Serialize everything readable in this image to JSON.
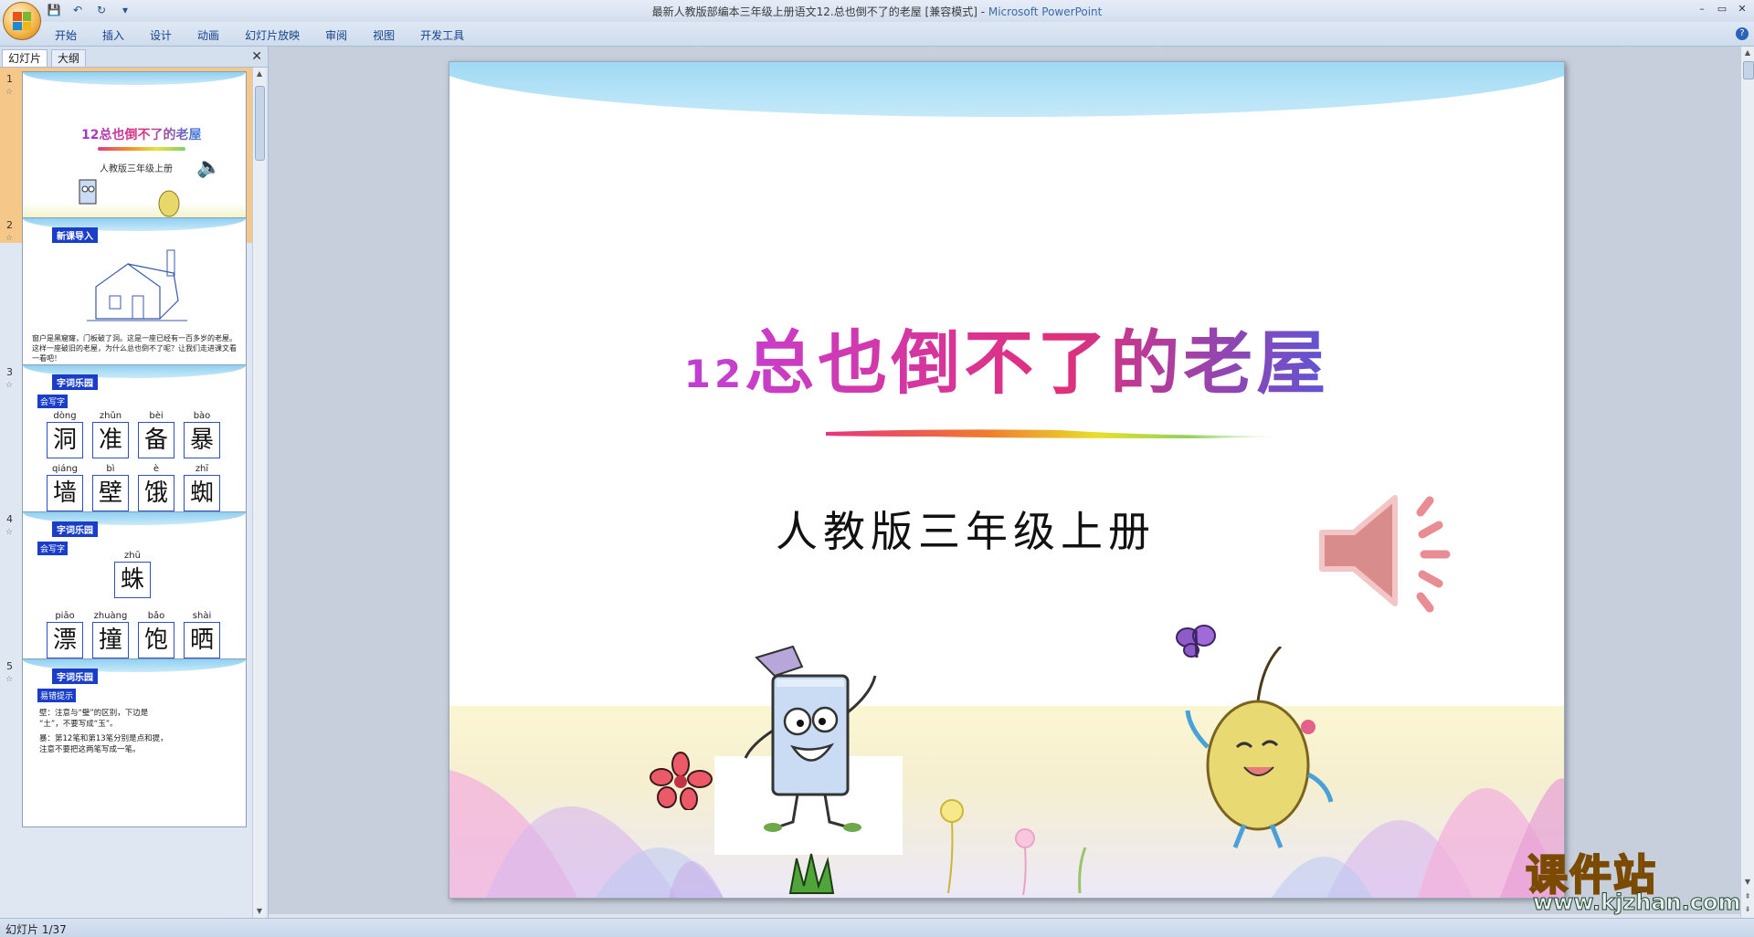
{
  "window": {
    "title": "最新人教版部编本三年级上册语文12.总也倒不了的老屋 [兼容模式]",
    "title_sep": " - ",
    "app_name": "Microsoft PowerPoint"
  },
  "qat": {
    "save": "💾",
    "undo": "↶",
    "redo": "↻",
    "more": "▾"
  },
  "ribbon": {
    "tabs": [
      "开始",
      "插入",
      "设计",
      "动画",
      "幻灯片放映",
      "审阅",
      "视图",
      "开发工具"
    ],
    "help": "?"
  },
  "window_controls": {
    "minimize": "–",
    "restore": "▭",
    "close": "✕"
  },
  "left_pane": {
    "tabs": [
      "幻灯片",
      "大纲"
    ],
    "close": "✕",
    "slides": [
      {
        "num": "1",
        "title": "12总也倒不了的老屋",
        "subtitle": "人教版三年级上册"
      },
      {
        "num": "2",
        "tag": "新课导入",
        "text": "窗户是黑窟窿，门板破了洞。这是一座已经有一百多岁的老屋。这样一座破旧的老屋，为什么总也倒不了呢？让我们走进课文看一看吧！"
      },
      {
        "num": "3",
        "tag": "字词乐园",
        "tag2": "会写字",
        "row1": [
          {
            "py": "dòng",
            "ch": "洞"
          },
          {
            "py": "zhǔn",
            "ch": "准"
          },
          {
            "py": "bèi",
            "ch": "备"
          },
          {
            "py": "bào",
            "ch": "暴"
          }
        ],
        "row2": [
          {
            "py": "qiáng",
            "ch": "墙"
          },
          {
            "py": "bì",
            "ch": "壁"
          },
          {
            "py": "è",
            "ch": "饿"
          },
          {
            "py": "zhī",
            "ch": "蜘"
          }
        ]
      },
      {
        "num": "4",
        "tag": "字词乐园",
        "tag2": "会写字",
        "single": {
          "py": "zhū",
          "ch": "蛛"
        },
        "row": [
          {
            "py": "piāo",
            "ch": "漂"
          },
          {
            "py": "zhuàng",
            "ch": "撞"
          },
          {
            "py": "bǎo",
            "ch": "饱"
          },
          {
            "py": "shài",
            "ch": "晒"
          }
        ]
      },
      {
        "num": "5",
        "tag": "字词乐园",
        "tag2": "易错提示",
        "lines": [
          "壁：注意与“璧”的区别，下边是",
          "“土”，不要写成“玉”。",
          "暴：第12笔和第13笔分别是点和提，",
          "注意不要把这两笔写成一笔。"
        ]
      }
    ]
  },
  "slide": {
    "title_num": "12",
    "title_text": "总也倒不了的老屋",
    "subtitle": "人教版三年级上册"
  },
  "watermark": {
    "main": "课件站",
    "url": "www.kjzhan.com"
  },
  "status": {
    "text": "幻灯片 1/37"
  },
  "colors": {
    "accent": "#1b3ec9",
    "selected_thumb": "#f5c88a",
    "sky": "#86cff0"
  }
}
